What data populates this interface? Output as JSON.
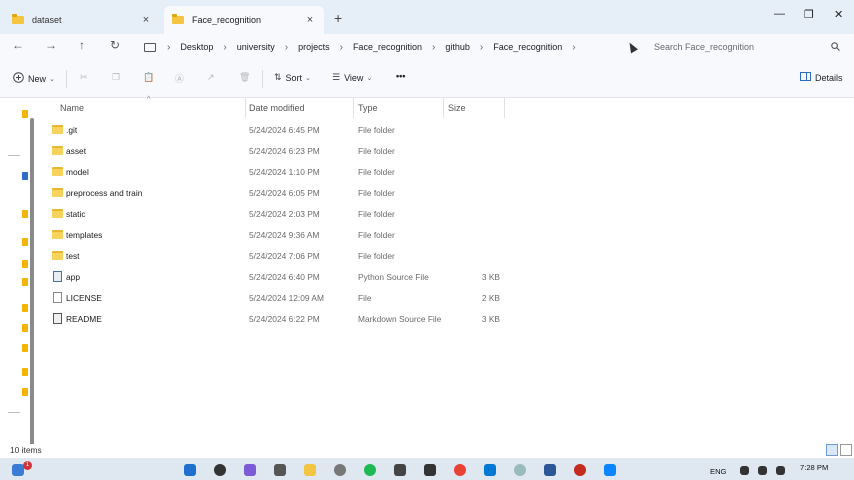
{
  "tabs": [
    {
      "label": "dataset",
      "active": false
    },
    {
      "label": "Face_recognition",
      "active": true
    }
  ],
  "window_controls": {
    "minimize": "—",
    "restore": "❐",
    "close": "✕"
  },
  "nav": {
    "back": "←",
    "forward": "→",
    "up": "↑",
    "refresh": "↻"
  },
  "breadcrumb": [
    "Desktop",
    "university",
    "projects",
    "Face_recognition",
    "github",
    "Face_recognition"
  ],
  "search": {
    "placeholder": "Search Face_recognition"
  },
  "commands": {
    "new": "New",
    "sort": "Sort",
    "view": "View",
    "more": "•••",
    "details": "Details"
  },
  "columns": {
    "name": "Name",
    "date": "Date modified",
    "type": "Type",
    "size": "Size"
  },
  "files": [
    {
      "name": ".git",
      "date": "5/24/2024 6:45 PM",
      "type": "File folder",
      "size": "",
      "icon": "folder"
    },
    {
      "name": "asset",
      "date": "5/24/2024 6:23 PM",
      "type": "File folder",
      "size": "",
      "icon": "folder"
    },
    {
      "name": "model",
      "date": "5/24/2024 1:10 PM",
      "type": "File folder",
      "size": "",
      "icon": "folder"
    },
    {
      "name": "preprocess and train",
      "date": "5/24/2024 6:05 PM",
      "type": "File folder",
      "size": "",
      "icon": "folder"
    },
    {
      "name": "static",
      "date": "5/24/2024 2:03 PM",
      "type": "File folder",
      "size": "",
      "icon": "folder"
    },
    {
      "name": "templates",
      "date": "5/24/2024 9:36 AM",
      "type": "File folder",
      "size": "",
      "icon": "folder"
    },
    {
      "name": "test",
      "date": "5/24/2024 7:06 PM",
      "type": "File folder",
      "size": "",
      "icon": "folder"
    },
    {
      "name": "app",
      "date": "5/24/2024 6:40 PM",
      "type": "Python Source File",
      "size": "3 KB",
      "icon": "py"
    },
    {
      "name": "LICENSE",
      "date": "5/24/2024 12:09 AM",
      "type": "File",
      "size": "2 KB",
      "icon": "file"
    },
    {
      "name": "README",
      "date": "5/24/2024 6:22 PM",
      "type": "Markdown Source File",
      "size": "3 KB",
      "icon": "md"
    }
  ],
  "status": {
    "items": "10 items"
  },
  "taskbar": {
    "lang": "ENG",
    "time": "7:28 PM",
    "badge": "1"
  }
}
